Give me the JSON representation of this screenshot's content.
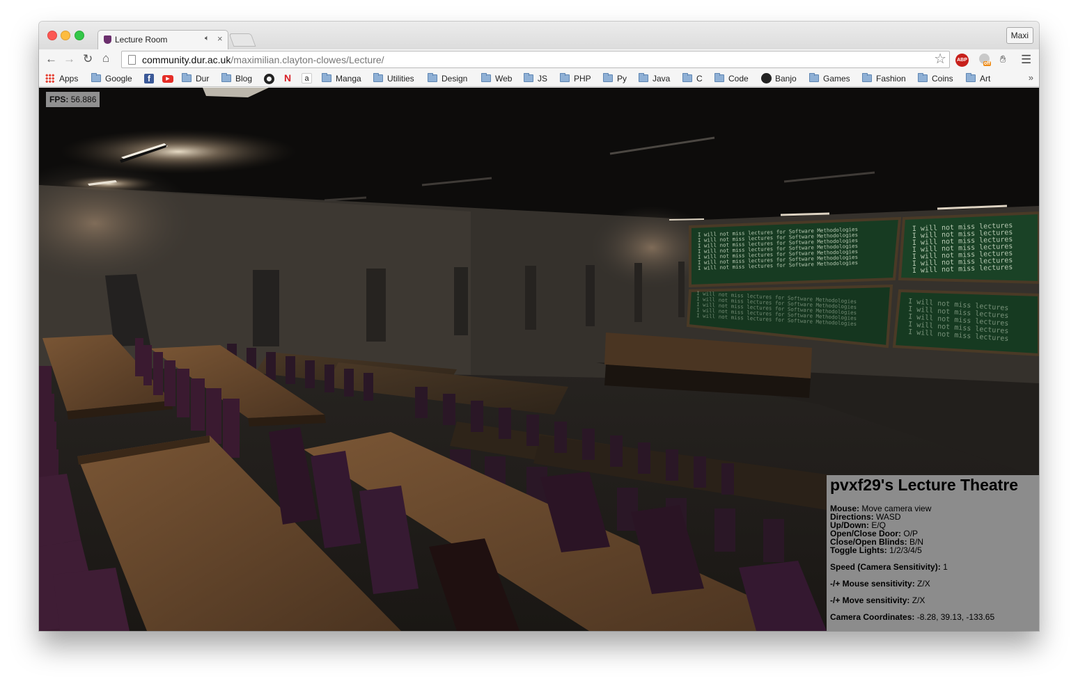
{
  "browser": {
    "profile_name": "Maxi",
    "tab": {
      "title": "Lecture Room",
      "audio_icon": "speaker-icon",
      "close_icon": "close-icon"
    },
    "address": {
      "host": "community.dur.ac.uk",
      "path": "/maximilian.clayton-clowes/Lecture/"
    },
    "extensions": [
      "adblock-plus-icon",
      "off-badge-icon",
      "hand-icon"
    ],
    "bookmarks": [
      {
        "label": "Apps",
        "icon": "apps-grid-icon"
      },
      {
        "label": "Google",
        "icon": "folder-icon"
      },
      {
        "label": "",
        "icon": "facebook-icon"
      },
      {
        "label": "",
        "icon": "youtube-icon"
      },
      {
        "label": "Dur",
        "icon": "folder-icon"
      },
      {
        "label": "Blog",
        "icon": "folder-icon"
      },
      {
        "label": "",
        "icon": "github-icon"
      },
      {
        "label": "",
        "icon": "netflix-icon"
      },
      {
        "label": "",
        "icon": "amazon-icon"
      },
      {
        "label": "Manga",
        "icon": "folder-icon"
      },
      {
        "label": "Utilities",
        "icon": "folder-icon"
      },
      {
        "label": "Design",
        "icon": "folder-icon"
      },
      {
        "label": "Web",
        "icon": "folder-icon"
      },
      {
        "label": "JS",
        "icon": "folder-icon"
      },
      {
        "label": "PHP",
        "icon": "folder-icon"
      },
      {
        "label": "Py",
        "icon": "folder-icon"
      },
      {
        "label": "Java",
        "icon": "folder-icon"
      },
      {
        "label": "C",
        "icon": "folder-icon"
      },
      {
        "label": "Code",
        "icon": "folder-icon"
      },
      {
        "label": "Banjo",
        "icon": "banjo-icon"
      },
      {
        "label": "Games",
        "icon": "folder-icon"
      },
      {
        "label": "Fashion",
        "icon": "folder-icon"
      },
      {
        "label": "Coins",
        "icon": "folder-icon"
      },
      {
        "label": "Art",
        "icon": "folder-icon"
      }
    ],
    "bookmarks_overflow": "»"
  },
  "app": {
    "fps": {
      "label": "FPS:",
      "value": "56.886"
    },
    "chalkboard": {
      "left_text": "I will not miss lectures for Software Methodologies",
      "right_text": "I will not miss lectures"
    },
    "info": {
      "title": "pvxf29's Lecture Theatre",
      "controls": [
        {
          "key": "Mouse:",
          "value": "Move camera view"
        },
        {
          "key": "Directions:",
          "value": "WASD"
        },
        {
          "key": "Up/Down:",
          "value": "E/Q"
        },
        {
          "key": "Open/Close Door:",
          "value": "O/P"
        },
        {
          "key": "Close/Open Blinds:",
          "value": "B/N"
        },
        {
          "key": "Toggle Lights:",
          "value": "1/2/3/4/5"
        }
      ],
      "speed": {
        "key": "Speed (Camera Sensitivity):",
        "value": "1"
      },
      "mouse_sensitivity": {
        "key": "-/+ Mouse sensitivity:",
        "value": "Z/X"
      },
      "move_sensitivity": {
        "key": "-/+ Move sensitivity:",
        "value": "Z/X"
      },
      "camera": {
        "key": "Camera Coordinates:",
        "value": "-8.28, 39.13, -133.65"
      }
    }
  },
  "colors": {
    "desk": "#6b4a2a",
    "chair": "#3a1a30",
    "chalkboard": "#173b22",
    "wall": "#3a3631",
    "ceiling": "#0c0b0a",
    "info_panel": "#8c8c8c"
  }
}
